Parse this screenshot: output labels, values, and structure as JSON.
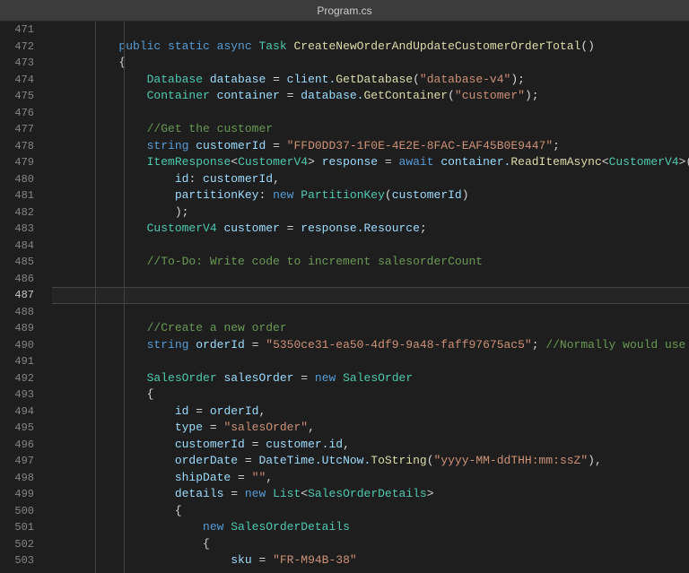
{
  "titlebar": {
    "filename": "Program.cs"
  },
  "editor": {
    "first_line_number": 471,
    "active_line": 487,
    "lines": [
      {
        "n": 471,
        "indent": 2,
        "tokens": []
      },
      {
        "n": 472,
        "indent": 2,
        "tokens": [
          {
            "t": "public ",
            "c": "kw"
          },
          {
            "t": "static ",
            "c": "kw"
          },
          {
            "t": "async ",
            "c": "kw"
          },
          {
            "t": "Task ",
            "c": "type"
          },
          {
            "t": "CreateNewOrderAndUpdateCustomerOrderTotal",
            "c": "fn"
          },
          {
            "t": "()",
            "c": "punc"
          }
        ]
      },
      {
        "n": 473,
        "indent": 2,
        "tokens": [
          {
            "t": "{",
            "c": "punc"
          }
        ]
      },
      {
        "n": 474,
        "indent": 3,
        "tokens": [
          {
            "t": "Database ",
            "c": "type"
          },
          {
            "t": "database ",
            "c": "var"
          },
          {
            "t": "= ",
            "c": "op"
          },
          {
            "t": "client.",
            "c": "var"
          },
          {
            "t": "GetDatabase",
            "c": "fn"
          },
          {
            "t": "(",
            "c": "punc"
          },
          {
            "t": "\"database-v4\"",
            "c": "str"
          },
          {
            "t": ");",
            "c": "punc"
          }
        ]
      },
      {
        "n": 475,
        "indent": 3,
        "tokens": [
          {
            "t": "Container ",
            "c": "type"
          },
          {
            "t": "container ",
            "c": "var"
          },
          {
            "t": "= ",
            "c": "op"
          },
          {
            "t": "database.",
            "c": "var"
          },
          {
            "t": "GetContainer",
            "c": "fn"
          },
          {
            "t": "(",
            "c": "punc"
          },
          {
            "t": "\"customer\"",
            "c": "str"
          },
          {
            "t": ");",
            "c": "punc"
          }
        ]
      },
      {
        "n": 476,
        "indent": 0,
        "tokens": []
      },
      {
        "n": 477,
        "indent": 3,
        "tokens": [
          {
            "t": "//Get the customer",
            "c": "com"
          }
        ]
      },
      {
        "n": 478,
        "indent": 3,
        "tokens": [
          {
            "t": "string ",
            "c": "kw"
          },
          {
            "t": "customerId ",
            "c": "var"
          },
          {
            "t": "= ",
            "c": "op"
          },
          {
            "t": "\"FFD0DD37-1F0E-4E2E-8FAC-EAF45B0E9447\"",
            "c": "str"
          },
          {
            "t": ";",
            "c": "punc"
          }
        ]
      },
      {
        "n": 479,
        "indent": 3,
        "tokens": [
          {
            "t": "ItemResponse",
            "c": "type"
          },
          {
            "t": "<",
            "c": "punc"
          },
          {
            "t": "CustomerV4",
            "c": "type"
          },
          {
            "t": "> ",
            "c": "punc"
          },
          {
            "t": "response ",
            "c": "var"
          },
          {
            "t": "= ",
            "c": "op"
          },
          {
            "t": "await ",
            "c": "kw"
          },
          {
            "t": "container.",
            "c": "var"
          },
          {
            "t": "ReadItemAsync",
            "c": "fn"
          },
          {
            "t": "<",
            "c": "punc"
          },
          {
            "t": "CustomerV4",
            "c": "type"
          },
          {
            "t": ">(",
            "c": "punc"
          }
        ]
      },
      {
        "n": 480,
        "indent": 4,
        "tokens": [
          {
            "t": "id",
            "c": "var"
          },
          {
            "t": ": ",
            "c": "punc"
          },
          {
            "t": "customerId",
            "c": "var"
          },
          {
            "t": ",",
            "c": "punc"
          }
        ]
      },
      {
        "n": 481,
        "indent": 4,
        "tokens": [
          {
            "t": "partitionKey",
            "c": "var"
          },
          {
            "t": ": ",
            "c": "punc"
          },
          {
            "t": "new ",
            "c": "kw"
          },
          {
            "t": "PartitionKey",
            "c": "type"
          },
          {
            "t": "(",
            "c": "punc"
          },
          {
            "t": "customerId",
            "c": "var"
          },
          {
            "t": ")",
            "c": "punc"
          }
        ]
      },
      {
        "n": 482,
        "indent": 4,
        "tokens": [
          {
            "t": ");",
            "c": "punc"
          }
        ]
      },
      {
        "n": 483,
        "indent": 3,
        "tokens": [
          {
            "t": "CustomerV4 ",
            "c": "type"
          },
          {
            "t": "customer ",
            "c": "var"
          },
          {
            "t": "= ",
            "c": "op"
          },
          {
            "t": "response.Resource",
            "c": "var"
          },
          {
            "t": ";",
            "c": "punc"
          }
        ]
      },
      {
        "n": 484,
        "indent": 0,
        "tokens": []
      },
      {
        "n": 485,
        "indent": 3,
        "tokens": [
          {
            "t": "//To-Do: Write code to increment salesorderCount",
            "c": "com"
          }
        ]
      },
      {
        "n": 486,
        "indent": 0,
        "tokens": []
      },
      {
        "n": 487,
        "indent": 0,
        "tokens": []
      },
      {
        "n": 488,
        "indent": 0,
        "tokens": []
      },
      {
        "n": 489,
        "indent": 3,
        "tokens": [
          {
            "t": "//Create a new order",
            "c": "com"
          }
        ]
      },
      {
        "n": 490,
        "indent": 3,
        "tokens": [
          {
            "t": "string ",
            "c": "kw"
          },
          {
            "t": "orderId ",
            "c": "var"
          },
          {
            "t": "= ",
            "c": "op"
          },
          {
            "t": "\"5350ce31-ea50-4df9-9a48-faff97675ac5\"",
            "c": "str"
          },
          {
            "t": "; ",
            "c": "punc"
          },
          {
            "t": "//Normally would use G",
            "c": "com"
          }
        ]
      },
      {
        "n": 491,
        "indent": 0,
        "tokens": []
      },
      {
        "n": 492,
        "indent": 3,
        "tokens": [
          {
            "t": "SalesOrder ",
            "c": "type"
          },
          {
            "t": "salesOrder ",
            "c": "var"
          },
          {
            "t": "= ",
            "c": "op"
          },
          {
            "t": "new ",
            "c": "kw"
          },
          {
            "t": "SalesOrder",
            "c": "type"
          }
        ]
      },
      {
        "n": 493,
        "indent": 3,
        "tokens": [
          {
            "t": "{",
            "c": "punc"
          }
        ]
      },
      {
        "n": 494,
        "indent": 4,
        "tokens": [
          {
            "t": "id ",
            "c": "var"
          },
          {
            "t": "= ",
            "c": "op"
          },
          {
            "t": "orderId",
            "c": "var"
          },
          {
            "t": ",",
            "c": "punc"
          }
        ]
      },
      {
        "n": 495,
        "indent": 4,
        "tokens": [
          {
            "t": "type ",
            "c": "var"
          },
          {
            "t": "= ",
            "c": "op"
          },
          {
            "t": "\"salesOrder\"",
            "c": "str"
          },
          {
            "t": ",",
            "c": "punc"
          }
        ]
      },
      {
        "n": 496,
        "indent": 4,
        "tokens": [
          {
            "t": "customerId ",
            "c": "var"
          },
          {
            "t": "= ",
            "c": "op"
          },
          {
            "t": "customer.id",
            "c": "var"
          },
          {
            "t": ",",
            "c": "punc"
          }
        ]
      },
      {
        "n": 497,
        "indent": 4,
        "tokens": [
          {
            "t": "orderDate ",
            "c": "var"
          },
          {
            "t": "= ",
            "c": "op"
          },
          {
            "t": "DateTime.UtcNow.",
            "c": "var"
          },
          {
            "t": "ToString",
            "c": "fn"
          },
          {
            "t": "(",
            "c": "punc"
          },
          {
            "t": "\"yyyy-MM-ddTHH:mm:ssZ\"",
            "c": "str"
          },
          {
            "t": "),",
            "c": "punc"
          }
        ]
      },
      {
        "n": 498,
        "indent": 4,
        "tokens": [
          {
            "t": "shipDate ",
            "c": "var"
          },
          {
            "t": "= ",
            "c": "op"
          },
          {
            "t": "\"\"",
            "c": "str"
          },
          {
            "t": ",",
            "c": "punc"
          }
        ]
      },
      {
        "n": 499,
        "indent": 4,
        "tokens": [
          {
            "t": "details ",
            "c": "var"
          },
          {
            "t": "= ",
            "c": "op"
          },
          {
            "t": "new ",
            "c": "kw"
          },
          {
            "t": "List",
            "c": "type"
          },
          {
            "t": "<",
            "c": "punc"
          },
          {
            "t": "SalesOrderDetails",
            "c": "type"
          },
          {
            "t": ">",
            "c": "punc"
          }
        ]
      },
      {
        "n": 500,
        "indent": 4,
        "tokens": [
          {
            "t": "{",
            "c": "punc"
          }
        ]
      },
      {
        "n": 501,
        "indent": 5,
        "tokens": [
          {
            "t": "new ",
            "c": "kw"
          },
          {
            "t": "SalesOrderDetails",
            "c": "type"
          }
        ]
      },
      {
        "n": 502,
        "indent": 5,
        "tokens": [
          {
            "t": "{",
            "c": "punc"
          }
        ]
      },
      {
        "n": 503,
        "indent": 6,
        "tokens": [
          {
            "t": "sku ",
            "c": "var"
          },
          {
            "t": "= ",
            "c": "op"
          },
          {
            "t": "\"FR-M94B-38\"",
            "c": "str"
          }
        ]
      }
    ]
  }
}
